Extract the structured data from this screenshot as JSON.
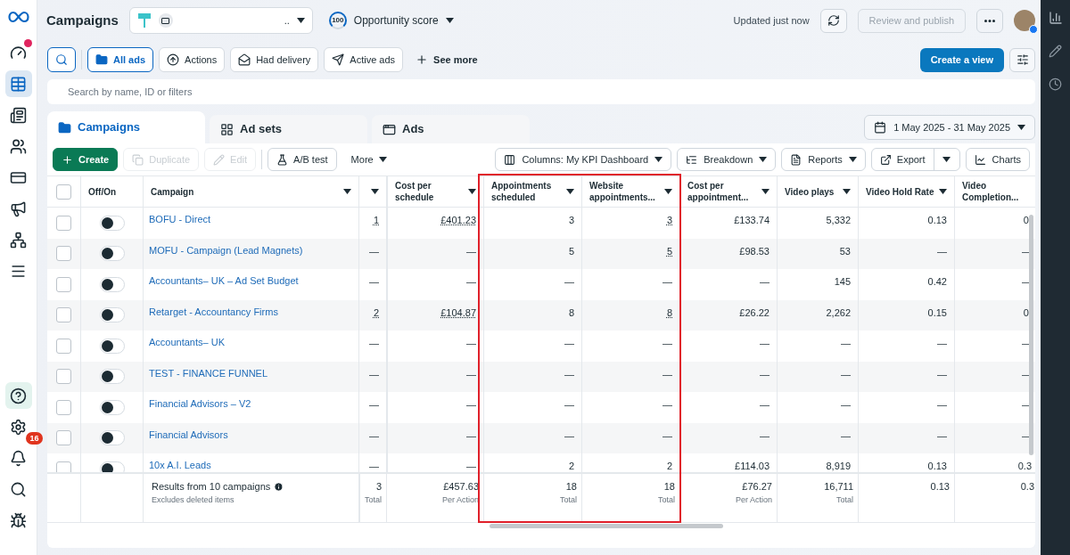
{
  "header": {
    "title": "Campaigns",
    "account": {
      "text": ".."
    },
    "score": {
      "value": "100",
      "label": "Opportunity score"
    },
    "updated": "Updated just now",
    "publish": {
      "label": "Review and publish",
      "disabled": true
    }
  },
  "sidebar": {
    "items": [
      {
        "kind": "gauge",
        "selected": false,
        "dot": true
      },
      {
        "kind": "table",
        "selected": true
      },
      {
        "kind": "pages",
        "selected": false
      },
      {
        "kind": "people",
        "selected": false
      },
      {
        "kind": "card",
        "selected": false
      },
      {
        "kind": "megaphone",
        "selected": false
      },
      {
        "kind": "tree",
        "selected": false
      },
      {
        "kind": "menu",
        "selected": false
      }
    ],
    "bottom": [
      {
        "kind": "help"
      },
      {
        "kind": "gear"
      },
      {
        "kind": "bell",
        "badge": "16"
      },
      {
        "kind": "search"
      },
      {
        "kind": "bug"
      }
    ]
  },
  "filters": [
    {
      "label": "All ads",
      "kind": "folder",
      "selected": true
    },
    {
      "label": "Actions",
      "kind": "actions",
      "selected": false
    },
    {
      "label": "Had delivery",
      "kind": "mail",
      "selected": false
    },
    {
      "label": "Active ads",
      "kind": "send",
      "selected": false
    }
  ],
  "see_more": "See more",
  "create_view": "Create a view",
  "search": {
    "placeholder": "Search by name, ID or filters"
  },
  "tabs": [
    {
      "label": "Campaigns",
      "kind": "campaigns",
      "selected": true
    },
    {
      "label": "Ad sets",
      "kind": "adsets",
      "selected": false
    },
    {
      "label": "Ads",
      "kind": "ads",
      "selected": false
    }
  ],
  "date_range": "1 May 2025 - 31 May 2025",
  "toolbar": {
    "left": [
      {
        "label": "Create",
        "kind": "create",
        "disabled": false
      },
      {
        "label": "Duplicate",
        "kind": "duplicate",
        "disabled": true
      },
      {
        "label": "Edit",
        "kind": "edit",
        "disabled": true
      },
      {
        "label": "A/B test",
        "kind": "abtest",
        "disabled": false
      },
      {
        "label": "More",
        "kind": "more",
        "disabled": false
      }
    ],
    "right": [
      {
        "label": "Columns: My KPI Dashboard",
        "kind": "columns"
      },
      {
        "label": "Breakdown",
        "kind": "breakdown"
      },
      {
        "label": "Reports",
        "kind": "reports"
      },
      {
        "label": "Export",
        "kind": "export"
      },
      {
        "label": "Charts",
        "kind": "charts"
      }
    ]
  },
  "table": {
    "select_all_checked": false,
    "columns": [
      "Off/On",
      "Campaign",
      "",
      "Cost per schedule",
      "Appointments scheduled",
      "Website appointments...",
      "Cost per appointment...",
      "Video plays",
      "Video Hold Rate",
      "Video Completion..."
    ],
    "rows": [
      {
        "checked": false,
        "on": false,
        "name": "BOFU - Direct",
        "cells": [
          {
            "text": "1",
            "underlined": true
          },
          {
            "text": "£401.23",
            "underlined": true
          },
          "3",
          {
            "text": "3",
            "underlined": true
          },
          "£133.74",
          "5,332",
          "0.13",
          "0."
        ]
      },
      {
        "checked": false,
        "on": false,
        "name": "MOFU - Campaign (Lead Magnets)",
        "cells": [
          "—",
          "—",
          "5",
          {
            "text": "5",
            "underlined": true
          },
          "£98.53",
          "53",
          "—",
          "—"
        ]
      },
      {
        "checked": false,
        "on": false,
        "name": "Accountants– UK – Ad Set Budget",
        "cells": [
          "—",
          "—",
          "—",
          "—",
          "—",
          "145",
          "0.42",
          "—"
        ]
      },
      {
        "checked": false,
        "on": false,
        "name": "Retarget - Accountancy Firms",
        "cells": [
          {
            "text": "2",
            "underlined": true
          },
          {
            "text": "£104.87",
            "underlined": true
          },
          "8",
          {
            "text": "8",
            "underlined": true
          },
          "£26.22",
          "2,262",
          "0.15",
          "0."
        ]
      },
      {
        "checked": false,
        "on": false,
        "name": "Accountants– UK",
        "cells": [
          "—",
          "—",
          "—",
          "—",
          "—",
          "—",
          "—",
          "—"
        ]
      },
      {
        "checked": false,
        "on": false,
        "name": "TEST - FINANCE FUNNEL",
        "cells": [
          "—",
          "—",
          "—",
          "—",
          "—",
          "—",
          "—",
          "—"
        ]
      },
      {
        "checked": false,
        "on": false,
        "name": "Financial Advisors – V2",
        "cells": [
          "—",
          "—",
          "—",
          "—",
          "—",
          "—",
          "—",
          "—"
        ]
      },
      {
        "checked": false,
        "on": false,
        "name": "Financial Advisors",
        "cells": [
          "—",
          "—",
          "—",
          "—",
          "—",
          "—",
          "—",
          "—"
        ]
      },
      {
        "checked": false,
        "on": false,
        "name": "10x A.I. Leads",
        "cells": [
          "—",
          "—",
          "2",
          "2",
          "£114.03",
          "8,919",
          "0.13",
          "0.3"
        ]
      }
    ],
    "footer": {
      "title": "Results from 10 campaigns",
      "note": "Excludes deleted items",
      "cells": [
        {
          "value": "3",
          "label": "Total"
        },
        {
          "value": "£457.63",
          "label": "Per Action"
        },
        {
          "value": "18",
          "label": "Total"
        },
        {
          "value": "18",
          "label": "Total"
        },
        {
          "value": "£76.27",
          "label": "Per Action"
        },
        {
          "value": "16,711",
          "label": "Total"
        },
        {
          "value": "0.13"
        },
        {
          "value": "0.3"
        }
      ]
    }
  }
}
